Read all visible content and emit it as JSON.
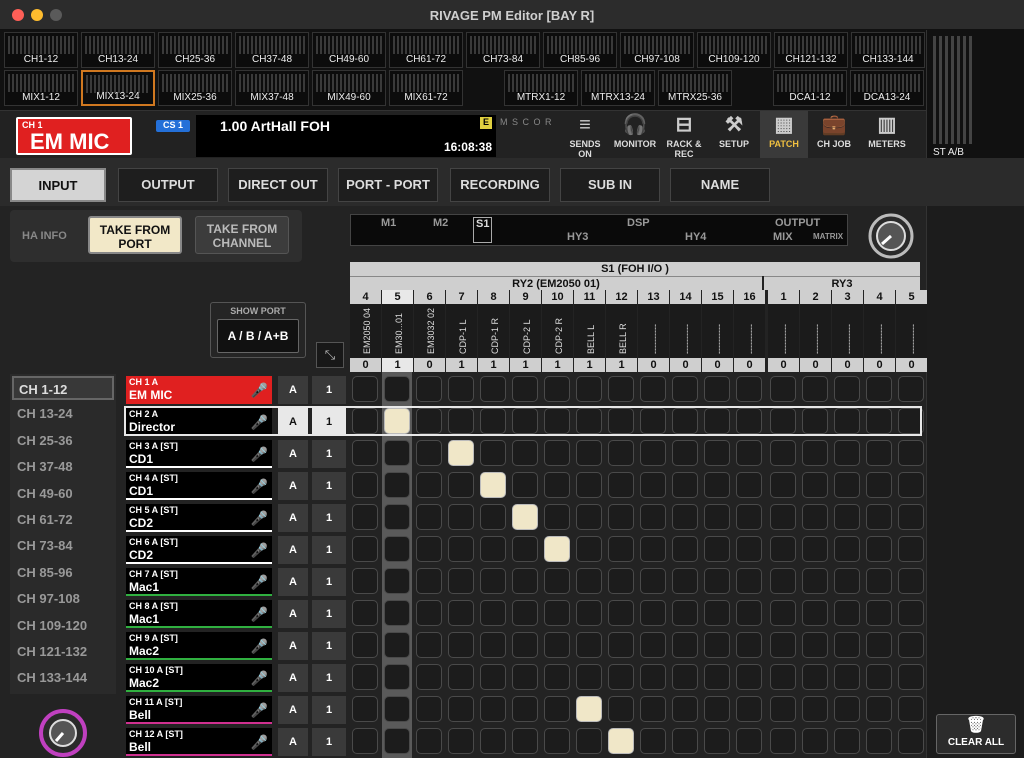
{
  "window": {
    "title": "RIVAGE PM Editor [BAY R]"
  },
  "banks_row1": [
    "CH1-12",
    "CH13-24",
    "CH25-36",
    "CH37-48",
    "CH49-60",
    "CH61-72",
    "CH73-84",
    "CH85-96",
    "CH97-108",
    "CH109-120",
    "CH121-132",
    "CH133-144"
  ],
  "banks_row2": [
    "MIX1-12",
    "MIX13-24",
    "MIX25-36",
    "MIX37-48",
    "MIX49-60",
    "MIX61-72",
    "MTRX1-12",
    "MTRX13-24",
    "MTRX25-36",
    "DCA1-12",
    "DCA13-24"
  ],
  "st_label": "ST A/B",
  "selected_channel": {
    "number": "CH 1",
    "name": "EM MIC"
  },
  "cs_badge": "CS 1",
  "scene": {
    "title": "1.00  ArtHall FOH",
    "time": "16:08:38",
    "edit_badge": "E",
    "status": "M S C O R"
  },
  "toolbar": [
    {
      "name": "sends-on-fader",
      "label": "SENDS ON FADER",
      "icon": "≡"
    },
    {
      "name": "monitor",
      "label": "MONITOR",
      "icon": "🎧"
    },
    {
      "name": "rack-rec",
      "label": "RACK & REC",
      "icon": "⊟"
    },
    {
      "name": "setup",
      "label": "SETUP",
      "icon": "⚒"
    },
    {
      "name": "patch",
      "label": "PATCH",
      "icon": "▦"
    },
    {
      "name": "ch-job",
      "label": "CH JOB",
      "icon": "💼"
    },
    {
      "name": "meters",
      "label": "METERS",
      "icon": "▥"
    }
  ],
  "tabs": [
    "INPUT",
    "OUTPUT",
    "DIRECT OUT",
    "PORT - PORT",
    "RECORDING",
    "SUB IN",
    "NAME"
  ],
  "ha_info": {
    "label": "HA INFO",
    "take_from_port": "TAKE FROM PORT",
    "take_from_channel": "TAKE FROM CHANNEL"
  },
  "overview": {
    "m1": "M1",
    "m2": "M2",
    "s1": "S1",
    "dsp": "DSP",
    "output": "OUTPUT",
    "hy3": "HY3",
    "hy4": "HY4",
    "mix": "MIX",
    "matrix": "MATRIX"
  },
  "header": {
    "s1": "S1 (FOH I/O )",
    "ry2": "RY2 (EM2050 01)",
    "ry3": "RY3"
  },
  "columns": [
    {
      "num": "4",
      "name": "EM2050 04",
      "val": "0"
    },
    {
      "num": "5",
      "name": "EM30...01",
      "val": "1"
    },
    {
      "num": "6",
      "name": "EM3032 02",
      "val": "0"
    },
    {
      "num": "7",
      "name": "CDP-1 L",
      "val": "1"
    },
    {
      "num": "8",
      "name": "CDP-1 R",
      "val": "1"
    },
    {
      "num": "9",
      "name": "CDP-2 L",
      "val": "1"
    },
    {
      "num": "10",
      "name": "CDP-2 R",
      "val": "1"
    },
    {
      "num": "11",
      "name": "BELL L",
      "val": "1"
    },
    {
      "num": "12",
      "name": "BELL R",
      "val": "1"
    },
    {
      "num": "13",
      "name": "----------",
      "val": "0"
    },
    {
      "num": "14",
      "name": "----------",
      "val": "0"
    },
    {
      "num": "15",
      "name": "----------",
      "val": "0"
    },
    {
      "num": "16",
      "name": "----------",
      "val": "0"
    },
    {
      "num": "1",
      "name": "----------",
      "val": "0"
    },
    {
      "num": "2",
      "name": "----------",
      "val": "0"
    },
    {
      "num": "3",
      "name": "----------",
      "val": "0"
    },
    {
      "num": "4",
      "name": "----------",
      "val": "0"
    },
    {
      "num": "5",
      "name": "----------",
      "val": "0"
    }
  ],
  "show_port": {
    "label": "SHOW PORT",
    "button": "A / B / A+B"
  },
  "bank_select": [
    "CH 1-12",
    "CH 13-24",
    "CH 25-36",
    "CH 37-48",
    "CH 49-60",
    "CH 61-72",
    "CH 73-84",
    "CH 85-96",
    "CH 97-108",
    "CH 109-120",
    "CH 121-132",
    "CH 133-144"
  ],
  "rows": [
    {
      "id": "CH 1 A",
      "name": "EM MIC",
      "port": "A",
      "num": "1",
      "color": "#e02020",
      "bar": "#e02020",
      "patch": -1
    },
    {
      "id": "CH 2 A",
      "name": "Director",
      "port": "A",
      "num": "1",
      "color": "#000000",
      "bar": "#2050d0",
      "patch": 1
    },
    {
      "id": "CH 3 A [ST]",
      "name": "CD1",
      "port": "A",
      "num": "1",
      "color": "#000000",
      "bar": "#ffffff",
      "patch": 3
    },
    {
      "id": "CH 4 A [ST]",
      "name": "CD1",
      "port": "A",
      "num": "1",
      "color": "#000000",
      "bar": "#ffffff",
      "patch": 4
    },
    {
      "id": "CH 5 A [ST]",
      "name": "CD2",
      "port": "A",
      "num": "1",
      "color": "#000000",
      "bar": "#ffffff",
      "patch": 5
    },
    {
      "id": "CH 6 A [ST]",
      "name": "CD2",
      "port": "A",
      "num": "1",
      "color": "#000000",
      "bar": "#ffffff",
      "patch": 6
    },
    {
      "id": "CH 7 A [ST]",
      "name": "Mac1",
      "port": "A",
      "num": "1",
      "color": "#000000",
      "bar": "#30b040",
      "patch": -1
    },
    {
      "id": "CH 8 A [ST]",
      "name": "Mac1",
      "port": "A",
      "num": "1",
      "color": "#000000",
      "bar": "#30b040",
      "patch": -1
    },
    {
      "id": "CH 9 A [ST]",
      "name": "Mac2",
      "port": "A",
      "num": "1",
      "color": "#000000",
      "bar": "#30b040",
      "patch": -1
    },
    {
      "id": "CH 10 A [ST]",
      "name": "Mac2",
      "port": "A",
      "num": "1",
      "color": "#000000",
      "bar": "#30b040",
      "patch": -1
    },
    {
      "id": "CH 11 A [ST]",
      "name": "Bell",
      "port": "A",
      "num": "1",
      "color": "#000000",
      "bar": "#d03090",
      "patch": 7
    },
    {
      "id": "CH 12 A [ST]",
      "name": "Bell",
      "port": "A",
      "num": "1",
      "color": "#000000",
      "bar": "#d03090",
      "patch": 8
    }
  ],
  "clear_all": "CLEAR ALL",
  "colors": {
    "accent": "#e02020",
    "selected_bank": "#d07820",
    "patch_on": "#f0e7c8"
  }
}
